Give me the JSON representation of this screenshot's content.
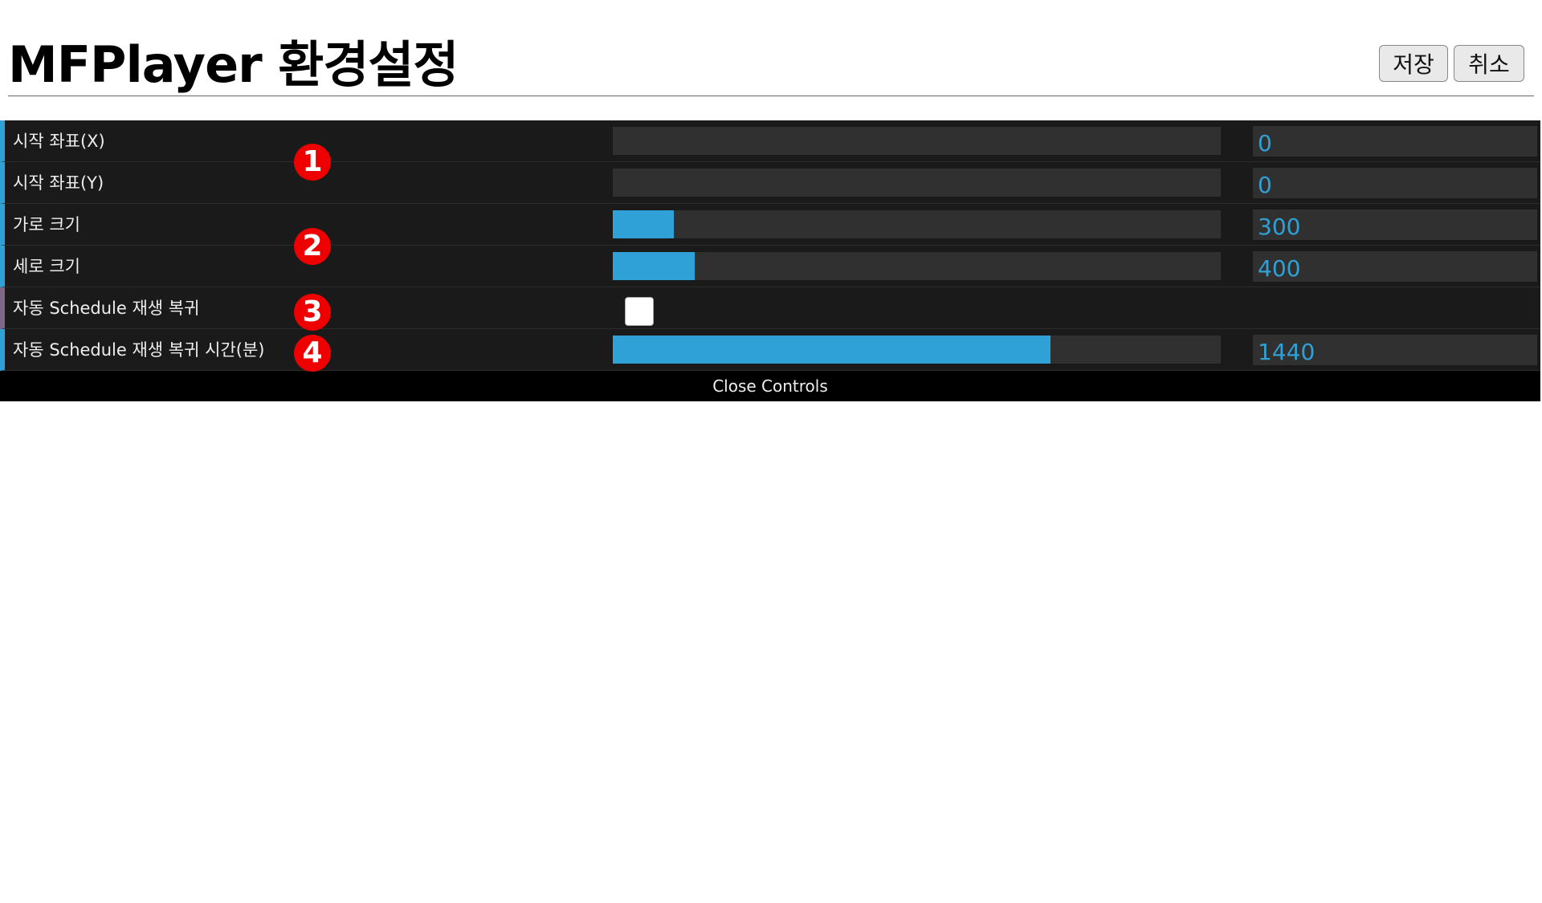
{
  "header": {
    "title": "MFPlayer 환경설정",
    "save_label": "저장",
    "cancel_label": "취소"
  },
  "controls": [
    {
      "label": "시작 좌표(X)",
      "type": "slider",
      "value": "0",
      "fill": 0.0
    },
    {
      "label": "시작 좌표(Y)",
      "type": "slider",
      "value": "0",
      "fill": 0.0
    },
    {
      "label": "가로 크기",
      "type": "slider",
      "value": "300",
      "fill": 0.1
    },
    {
      "label": "세로 크기",
      "type": "slider",
      "value": "400",
      "fill": 0.135
    },
    {
      "label": "자동 Schedule 재생 복귀",
      "type": "checkbox",
      "checked": false
    },
    {
      "label": "자동 Schedule 재생 복귀 시간(분)",
      "type": "slider",
      "value": "1440",
      "fill": 0.72
    }
  ],
  "close_label": "Close Controls",
  "markers": [
    "1",
    "2",
    "3",
    "4"
  ],
  "colors": {
    "accent": "#2fa1d6",
    "panel_bg": "#1a1a1a",
    "slider_bg": "#303030",
    "marker": "#ee0000"
  }
}
